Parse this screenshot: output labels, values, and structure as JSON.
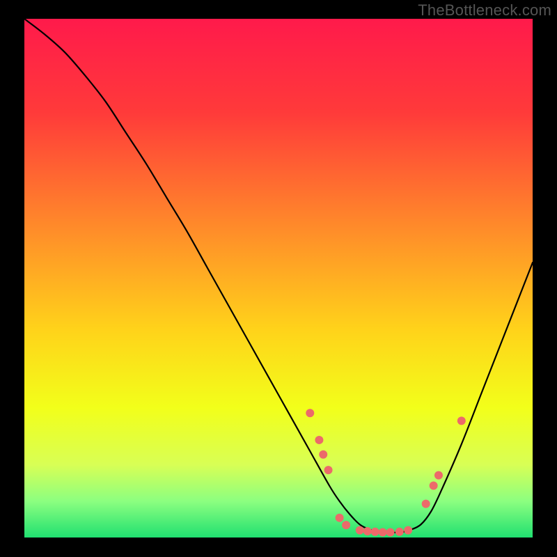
{
  "attribution": "TheBottleneck.com",
  "chart_data": {
    "type": "line",
    "title": "",
    "xlabel": "",
    "ylabel": "",
    "xlim": [
      0,
      100
    ],
    "ylim": [
      0,
      100
    ],
    "background_gradient": {
      "stops": [
        {
          "offset": 0,
          "color": "#ff1a4b"
        },
        {
          "offset": 0.18,
          "color": "#ff3a3a"
        },
        {
          "offset": 0.4,
          "color": "#ff8a2a"
        },
        {
          "offset": 0.6,
          "color": "#ffd31a"
        },
        {
          "offset": 0.75,
          "color": "#f2ff1a"
        },
        {
          "offset": 0.86,
          "color": "#d8ff55"
        },
        {
          "offset": 0.93,
          "color": "#8cff80"
        },
        {
          "offset": 1.0,
          "color": "#20e070"
        }
      ]
    },
    "series": [
      {
        "name": "bottleneck-curve",
        "color": "#000000",
        "stroke_width": 2.2,
        "x": [
          0,
          4,
          8,
          12,
          16,
          20,
          24,
          28,
          32,
          36,
          40,
          44,
          48,
          52,
          56,
          60,
          62,
          64,
          66,
          68,
          70,
          72,
          74,
          76,
          78,
          80,
          82,
          86,
          90,
          94,
          98,
          100
        ],
        "y": [
          100,
          97,
          93.5,
          89,
          84,
          78,
          72,
          65.5,
          59,
          52,
          45,
          38,
          31,
          24,
          17,
          10,
          7,
          4.5,
          2.5,
          1.5,
          1,
          1,
          1,
          1.5,
          2.5,
          5,
          9,
          18,
          28,
          38,
          48,
          53
        ]
      }
    ],
    "markers": {
      "color": "#ec6a6a",
      "radius": 6,
      "points": [
        {
          "x": 56.2,
          "y": 24.0
        },
        {
          "x": 58.0,
          "y": 18.8
        },
        {
          "x": 58.8,
          "y": 16.0
        },
        {
          "x": 59.8,
          "y": 13.0
        },
        {
          "x": 62.0,
          "y": 3.8
        },
        {
          "x": 63.3,
          "y": 2.4
        },
        {
          "x": 66.0,
          "y": 1.4
        },
        {
          "x": 67.5,
          "y": 1.2
        },
        {
          "x": 69.0,
          "y": 1.1
        },
        {
          "x": 70.5,
          "y": 1.0
        },
        {
          "x": 72.0,
          "y": 1.0
        },
        {
          "x": 73.8,
          "y": 1.1
        },
        {
          "x": 75.5,
          "y": 1.4
        },
        {
          "x": 79.0,
          "y": 6.5
        },
        {
          "x": 80.5,
          "y": 10.0
        },
        {
          "x": 81.5,
          "y": 12.0
        },
        {
          "x": 86.0,
          "y": 22.5
        }
      ]
    }
  }
}
